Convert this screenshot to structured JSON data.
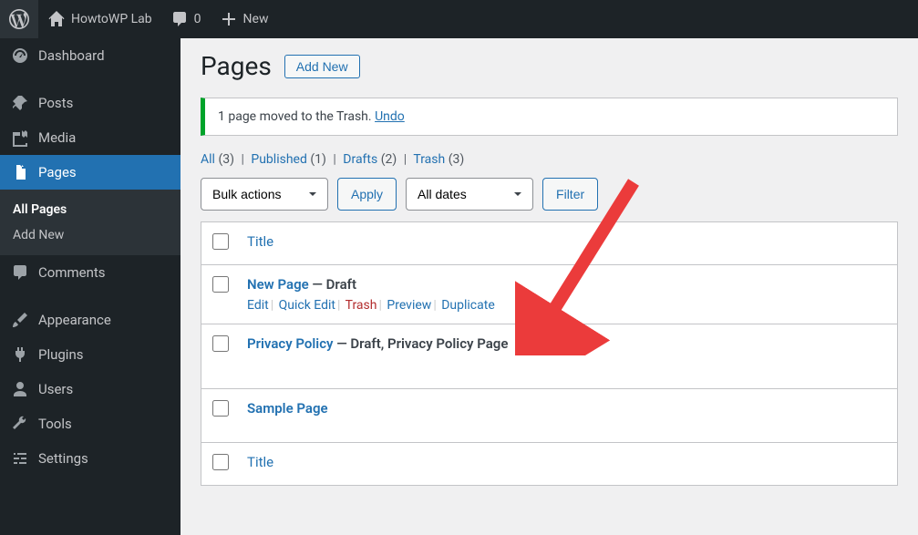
{
  "adminbar": {
    "site_name": "HowtoWP Lab",
    "comments_count": "0",
    "new_label": "New"
  },
  "sidebar": {
    "dashboard": "Dashboard",
    "posts": "Posts",
    "media": "Media",
    "pages": "Pages",
    "pages_sub": {
      "all": "All Pages",
      "add": "Add New"
    },
    "comments": "Comments",
    "appearance": "Appearance",
    "plugins": "Plugins",
    "users": "Users",
    "tools": "Tools",
    "settings": "Settings"
  },
  "page": {
    "title": "Pages",
    "add_new": "Add New"
  },
  "notice": {
    "text": "1 page moved to the Trash. ",
    "undo": "Undo"
  },
  "filters": {
    "all": "All",
    "all_count": "(3)",
    "published": "Published",
    "published_count": "(1)",
    "drafts": "Drafts",
    "drafts_count": "(2)",
    "trash": "Trash",
    "trash_count": "(3)"
  },
  "bulk": {
    "label": "Bulk actions",
    "apply": "Apply"
  },
  "date_filter": {
    "label": "All dates",
    "filter": "Filter"
  },
  "table": {
    "title_col": "Title",
    "rows": [
      {
        "title": "New Page",
        "state": " — Draft",
        "actions": {
          "edit": "Edit",
          "quick_edit": "Quick Edit",
          "trash": "Trash",
          "preview": "Preview",
          "duplicate": "Duplicate"
        }
      },
      {
        "title": "Privacy Policy",
        "state": " — Draft, Privacy Policy Page"
      },
      {
        "title": "Sample Page",
        "state": ""
      }
    ]
  }
}
